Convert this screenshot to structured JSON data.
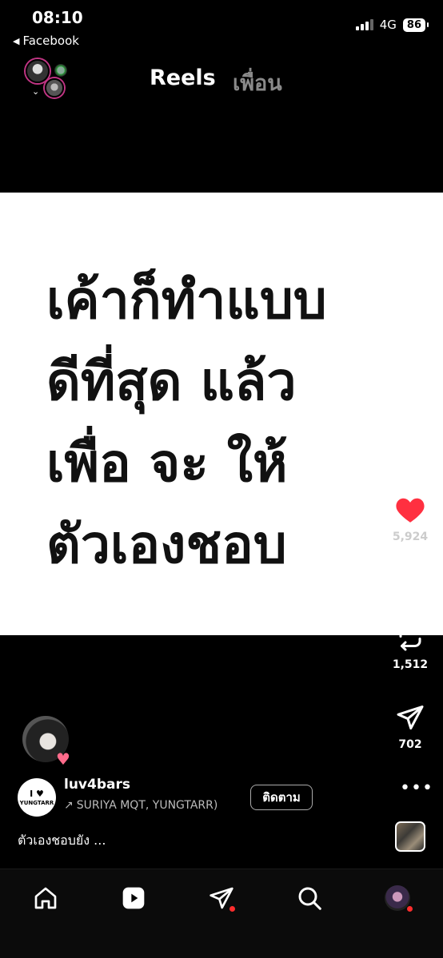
{
  "status_bar": {
    "time": "08:10",
    "back_app": "Facebook",
    "network": "4G",
    "battery": "86"
  },
  "top_nav": {
    "tabs": [
      {
        "label": "Reels",
        "active": true
      },
      {
        "label": "เพื่อน",
        "active": false
      }
    ]
  },
  "video": {
    "overlay_text": "เค้าก็ทำแบบ\nดีที่สุด  แล้ว\nเพื่อ จะ  ให้\nตัวเองชอบ"
  },
  "actions": {
    "likes": "5,924",
    "reposts": "1,512",
    "shares": "702"
  },
  "post": {
    "author": "luv4bars",
    "logo_line1": "I ♥",
    "logo_line2": "YUNGTARR",
    "collaborators": "SURIYA MQT, YUNGTARR)",
    "follow_label": "ติดตาม",
    "caption": "ตัวเองชอบยัง ...",
    "more_label": "•••"
  },
  "colors": {
    "like": "#ff3040",
    "notification_dot": "#ff2d2d",
    "background": "#000000"
  },
  "icons": [
    "heart-icon",
    "comment-icon",
    "repost-icon",
    "send-icon",
    "home-icon",
    "reels-icon",
    "search-icon"
  ]
}
